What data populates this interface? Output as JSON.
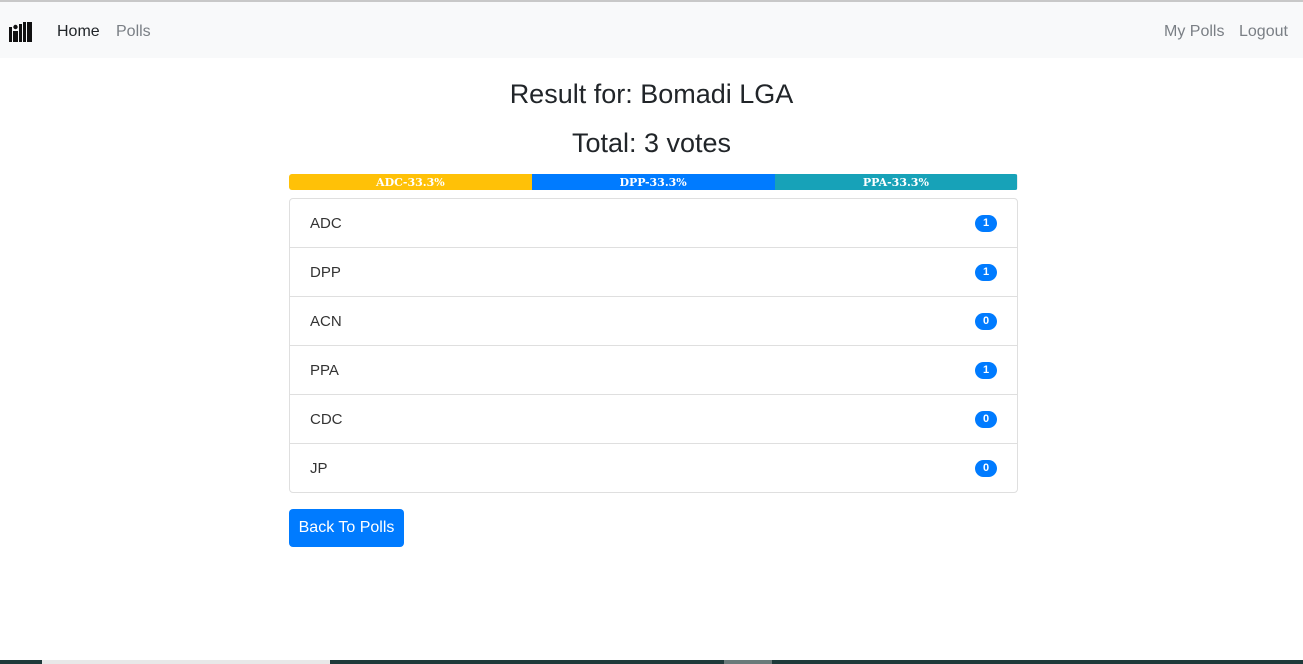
{
  "nav": {
    "brand_icon": "ballot-logo-icon",
    "home_label": "Home",
    "polls_label": "Polls",
    "mypolls_label": "My Polls",
    "logout_label": "Logout"
  },
  "result": {
    "title": "Result for: Bomadi LGA",
    "total": "Total: 3 votes"
  },
  "progress": [
    {
      "label": "ADC-33.3%",
      "percent": 33.3,
      "color": "#ffc107"
    },
    {
      "label": "DPP-33.3%",
      "percent": 33.3,
      "color": "#007bff"
    },
    {
      "label": "PPA-33.3%",
      "percent": 33.3,
      "color": "#17a2b8"
    }
  ],
  "parties": [
    {
      "name": "ADC",
      "votes": "1"
    },
    {
      "name": "DPP",
      "votes": "1"
    },
    {
      "name": "ACN",
      "votes": "0"
    },
    {
      "name": "PPA",
      "votes": "1"
    },
    {
      "name": "CDC",
      "votes": "0"
    },
    {
      "name": "JP",
      "votes": "0"
    }
  ],
  "actions": {
    "back_label": "Back To Polls"
  },
  "colors": {
    "primary": "#007bff",
    "warning": "#ffc107",
    "info": "#17a2b8"
  }
}
